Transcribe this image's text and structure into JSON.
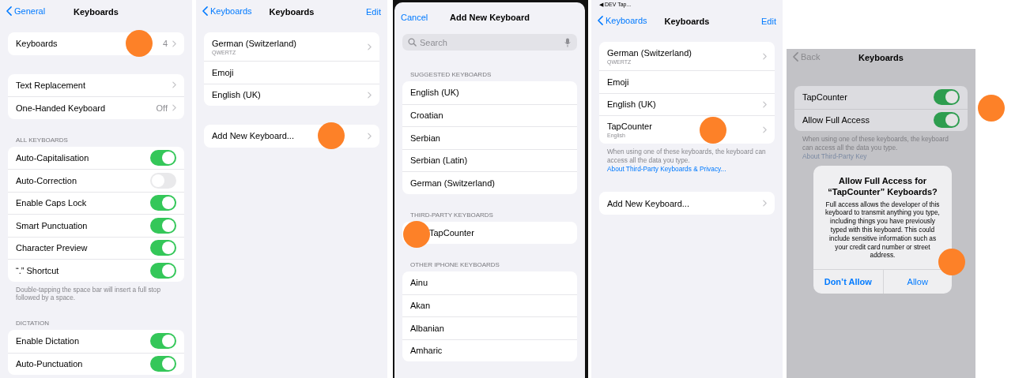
{
  "screens": [
    {
      "kind": "settings",
      "nav": {
        "back": "General",
        "title": "Keyboards"
      },
      "groups": [
        {
          "rows": [
            {
              "kind": "link",
              "label": "Keyboards",
              "value": "4"
            }
          ]
        },
        {
          "rows": [
            {
              "kind": "link",
              "label": "Text Replacement"
            },
            {
              "kind": "link",
              "label": "One-Handed Keyboard",
              "value": "Off"
            }
          ]
        },
        {
          "header": "ALL KEYBOARDS",
          "rows": [
            {
              "kind": "toggle",
              "label": "Auto-Capitalisation",
              "on": true
            },
            {
              "kind": "toggle",
              "label": "Auto-Correction",
              "on": false
            },
            {
              "kind": "toggle",
              "label": "Enable Caps Lock",
              "on": true
            },
            {
              "kind": "toggle",
              "label": "Smart Punctuation",
              "on": true
            },
            {
              "kind": "toggle",
              "label": "Character Preview",
              "on": true
            },
            {
              "kind": "toggle",
              "label": "“.” Shortcut",
              "on": true
            }
          ],
          "footer": {
            "text": "Double-tapping the space bar will insert a full stop followed by a space."
          }
        },
        {
          "header": "DICTATION",
          "rows": [
            {
              "kind": "toggle",
              "label": "Enable Dictation",
              "on": true
            },
            {
              "kind": "toggle",
              "label": "Auto-Punctuation",
              "on": true
            }
          ]
        }
      ]
    },
    {
      "kind": "settings",
      "nav": {
        "back": "Keyboards",
        "title": "Keyboards",
        "action": "Edit"
      },
      "groups": [
        {
          "rows": [
            {
              "kind": "link",
              "label": "German (Switzerland)",
              "sublabel": "QWERTZ"
            },
            {
              "kind": "plain",
              "label": "Emoji"
            },
            {
              "kind": "link",
              "label": "English (UK)"
            }
          ]
        },
        {
          "rows": [
            {
              "kind": "link",
              "label": "Add New Keyboard..."
            }
          ]
        }
      ]
    },
    {
      "kind": "sheet",
      "nav": {
        "cancel": "Cancel",
        "title": "Add New Keyboard"
      },
      "search": {
        "placeholder": "Search"
      },
      "groups": [
        {
          "header": "SUGGESTED KEYBOARDS",
          "rows": [
            {
              "kind": "plain",
              "label": "English (UK)"
            },
            {
              "kind": "plain",
              "label": "Croatian"
            },
            {
              "kind": "plain",
              "label": "Serbian"
            },
            {
              "kind": "plain",
              "label": "Serbian (Latin)"
            },
            {
              "kind": "plain",
              "label": "German (Switzerland)"
            }
          ]
        },
        {
          "header": "THIRD-PARTY KEYBOARDS",
          "rows": [
            {
              "kind": "app",
              "label": "TapCounter"
            }
          ]
        },
        {
          "header": "OTHER IPHONE KEYBOARDS",
          "rows": [
            {
              "kind": "plain",
              "label": "Ainu"
            },
            {
              "kind": "plain",
              "label": "Akan"
            },
            {
              "kind": "plain",
              "label": "Albanian"
            },
            {
              "kind": "plain",
              "label": "Amharic"
            }
          ]
        }
      ]
    },
    {
      "kind": "settings",
      "status_bar": {
        "back_app": "◀ DEV Tap..."
      },
      "nav": {
        "back": "Keyboards",
        "title": "Keyboards",
        "action": "Edit"
      },
      "groups": [
        {
          "rows": [
            {
              "kind": "link",
              "label": "German (Switzerland)",
              "sublabel": "QWERTZ"
            },
            {
              "kind": "plain",
              "label": "Emoji"
            },
            {
              "kind": "link",
              "label": "English (UK)"
            },
            {
              "kind": "link",
              "label": "TapCounter",
              "sublabel": "English"
            }
          ],
          "footer": {
            "text": "When using one of these keyboards, the keyboard can access all the data you type.",
            "link": "About Third-Party Keyboards & Privacy..."
          }
        },
        {
          "rows": [
            {
              "kind": "link",
              "label": "Add New Keyboard..."
            }
          ]
        }
      ]
    },
    {
      "kind": "dimmed",
      "nav": {
        "back": "Back",
        "title": "Keyboards"
      },
      "groups": [
        {
          "rows": [
            {
              "kind": "toggle",
              "label": "TapCounter",
              "on": true
            },
            {
              "kind": "toggle",
              "label": "Allow Full Access",
              "on": true
            }
          ],
          "footer": {
            "text": "When using one of these keyboards, the keyboard can access all the data you type.",
            "link": "About Third-Party Key"
          }
        }
      ],
      "alert": {
        "title": "Allow Full Access for “TapCounter” Keyboards?",
        "message": "Full access allows the developer of this keyboard to transmit anything you type, including things you have previously typed with this keyboard. This could include sensitive information such as your credit card number or street address.",
        "buttons": [
          {
            "label": "Don’t Allow",
            "kind": "preferred"
          },
          {
            "label": "Allow",
            "kind": "default"
          }
        ]
      }
    }
  ]
}
